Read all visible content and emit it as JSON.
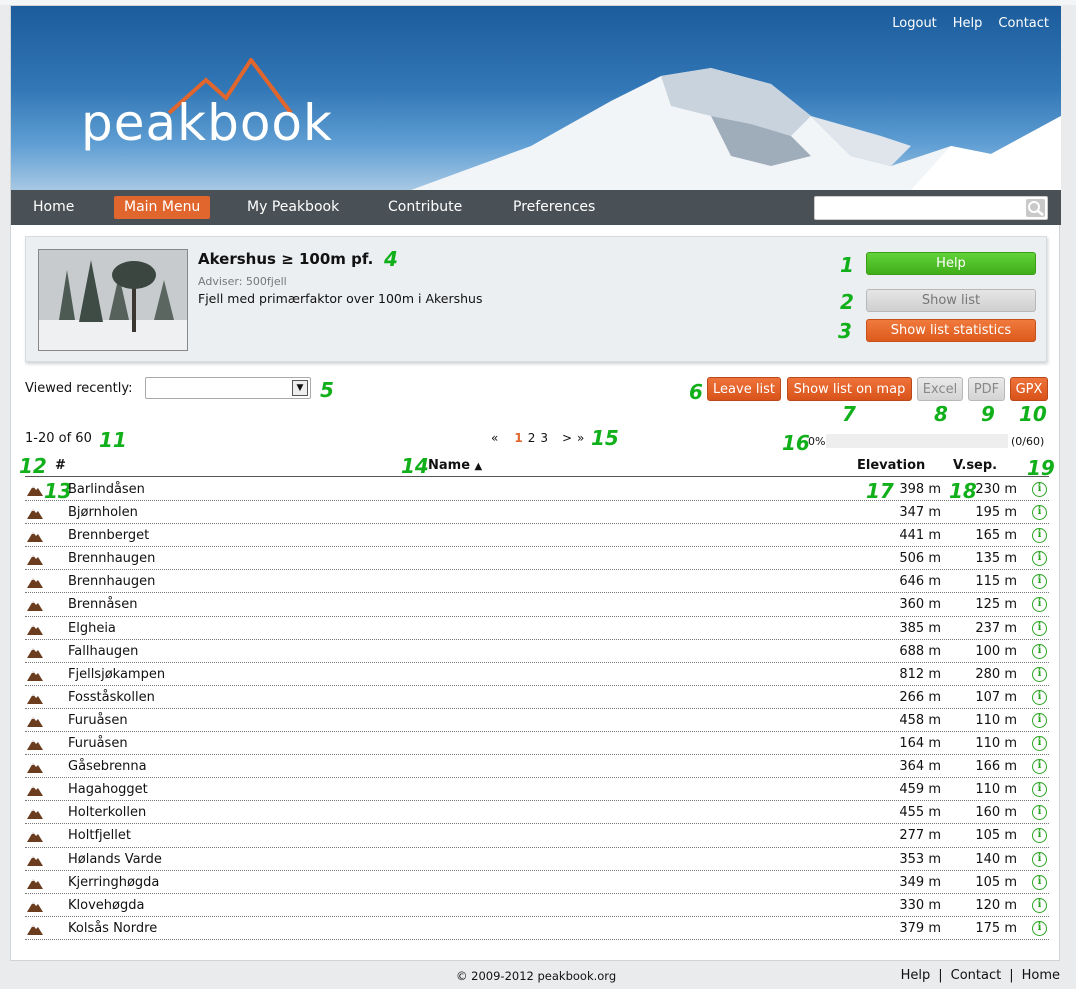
{
  "header": {
    "logo_text": "peakbook",
    "top_links": [
      "Logout",
      "Help",
      "Contact"
    ]
  },
  "nav": {
    "items": [
      "Home",
      "Main Menu",
      "My Peakbook",
      "Contribute",
      "Preferences"
    ],
    "active": "Main Menu",
    "search_placeholder": ""
  },
  "list": {
    "title": "Akershus ≥ 100m pf.",
    "adviser": "Adviser: 500fjell",
    "description": "Fjell med primærfaktor over 100m i Akershus",
    "help_label": "Help",
    "show_list_label": "Show list",
    "show_stats_label": "Show list statistics"
  },
  "toolbar": {
    "viewed_recently_label": "Viewed recently:",
    "viewed_recently_value": "",
    "leave_list": "Leave list",
    "show_on_map": "Show list on map",
    "excel": "Excel",
    "pdf": "PDF",
    "gpx": "GPX"
  },
  "paging": {
    "range": "1-20 of 60",
    "first": "«",
    "pages": [
      "1",
      "2",
      "3"
    ],
    "current": "1",
    "next": ">",
    "last": "»"
  },
  "progress": {
    "percent_text": "0%",
    "fraction": 0,
    "count_text": "(0/60)"
  },
  "table": {
    "headers": {
      "num": "#",
      "name": "Name",
      "sort_indicator": "▲",
      "elevation": "Elevation",
      "vsep": "V.sep."
    },
    "rows": [
      {
        "name": "Barlindåsen",
        "elevation": "398 m",
        "vsep": "230 m"
      },
      {
        "name": "Bjørnholen",
        "elevation": "347 m",
        "vsep": "195 m"
      },
      {
        "name": "Brennberget",
        "elevation": "441 m",
        "vsep": "165 m"
      },
      {
        "name": "Brennhaugen",
        "elevation": "506 m",
        "vsep": "135 m"
      },
      {
        "name": "Brennhaugen",
        "elevation": "646 m",
        "vsep": "115 m"
      },
      {
        "name": "Brennåsen",
        "elevation": "360 m",
        "vsep": "125 m"
      },
      {
        "name": "Elgheia",
        "elevation": "385 m",
        "vsep": "237 m"
      },
      {
        "name": "Fallhaugen",
        "elevation": "688 m",
        "vsep": "100 m"
      },
      {
        "name": "Fjellsjøkampen",
        "elevation": "812 m",
        "vsep": "280 m"
      },
      {
        "name": "Fosståskollen",
        "elevation": "266 m",
        "vsep": "107 m"
      },
      {
        "name": "Furuåsen",
        "elevation": "458 m",
        "vsep": "110 m"
      },
      {
        "name": "Furuåsen",
        "elevation": "164 m",
        "vsep": "110 m"
      },
      {
        "name": "Gåsebrenna",
        "elevation": "364 m",
        "vsep": "166 m"
      },
      {
        "name": "Hagahogget",
        "elevation": "459 m",
        "vsep": "110 m"
      },
      {
        "name": "Holterkollen",
        "elevation": "455 m",
        "vsep": "160 m"
      },
      {
        "name": "Holtfjellet",
        "elevation": "277 m",
        "vsep": "105 m"
      },
      {
        "name": "Hølands Varde",
        "elevation": "353 m",
        "vsep": "140 m"
      },
      {
        "name": "Kjerringhøgda",
        "elevation": "349 m",
        "vsep": "105 m"
      },
      {
        "name": "Klovehøgda",
        "elevation": "330 m",
        "vsep": "120 m"
      },
      {
        "name": "Kolsås Nordre",
        "elevation": "379 m",
        "vsep": "175 m"
      }
    ]
  },
  "annotations": [
    "1",
    "2",
    "3",
    "4",
    "5",
    "6",
    "7",
    "8",
    "9",
    "10",
    "11",
    "12",
    "13",
    "14",
    "15",
    "16",
    "17",
    "18",
    "19"
  ],
  "footer": {
    "copyright": "© 2009-2012 peakbook.org",
    "links": [
      "Help",
      "Contact",
      "Home"
    ],
    "separator": "|"
  },
  "colors": {
    "accent_orange": "#e0662d",
    "help_green": "#4cc023",
    "annotation_green": "#11b01a",
    "nav_bg": "#4a5156"
  },
  "icons": {
    "peak": "mountain-icon",
    "info": "info-icon",
    "search": "search-icon",
    "dropdown": "dropdown-arrow-icon"
  }
}
